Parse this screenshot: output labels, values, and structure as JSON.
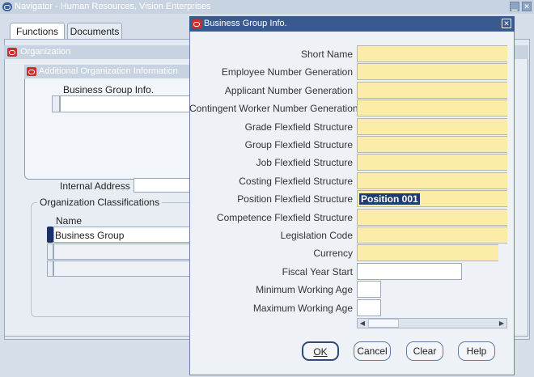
{
  "navigator": {
    "title": "Navigator - Human Resources, Vision Enterprises",
    "tabs": [
      "Functions",
      "Documents"
    ]
  },
  "organization": {
    "title": "Organization",
    "additional_info_title": "Additional Organization Information",
    "business_group_info_label": "Business Group Info.",
    "internal_address_label": "Internal Address",
    "classifications_title": "Organization Classifications",
    "name_header": "Name",
    "classification_row_1": "Business Group"
  },
  "dialog": {
    "title": "Business Group Info.",
    "fields": [
      {
        "label": "Short Name",
        "value": "",
        "required": true
      },
      {
        "label": "Employee Number Generation",
        "value": "",
        "required": true
      },
      {
        "label": "Applicant Number Generation",
        "value": "",
        "required": true
      },
      {
        "label": "Contingent Worker Number Generation",
        "value": "",
        "required": true
      },
      {
        "label": "Grade Flexfield Structure",
        "value": "",
        "required": true
      },
      {
        "label": "Group Flexfield Structure",
        "value": "",
        "required": true
      },
      {
        "label": "Job Flexfield Structure",
        "value": "",
        "required": true
      },
      {
        "label": "Costing Flexfield Structure",
        "value": "",
        "required": true
      },
      {
        "label": "Position Flexfield Structure",
        "value": "Position 001",
        "required": true
      },
      {
        "label": "Competence Flexfield Structure",
        "value": "",
        "required": true
      },
      {
        "label": "Legislation Code",
        "value": "",
        "required": true
      },
      {
        "label": "Currency",
        "value": "",
        "required": true
      },
      {
        "label": "Fiscal Year Start",
        "value": "",
        "required": false
      },
      {
        "label": "Minimum Working Age",
        "value": "",
        "required": false
      },
      {
        "label": "Maximum Working Age",
        "value": "",
        "required": false
      }
    ],
    "buttons": {
      "ok": "OK",
      "cancel": "Cancel",
      "clear": "Clear",
      "help": "Help"
    }
  },
  "colors": {
    "required_field": "#fbeca8",
    "selection": "#1f3c6e",
    "titlebar_active": "#3a5a8f"
  }
}
